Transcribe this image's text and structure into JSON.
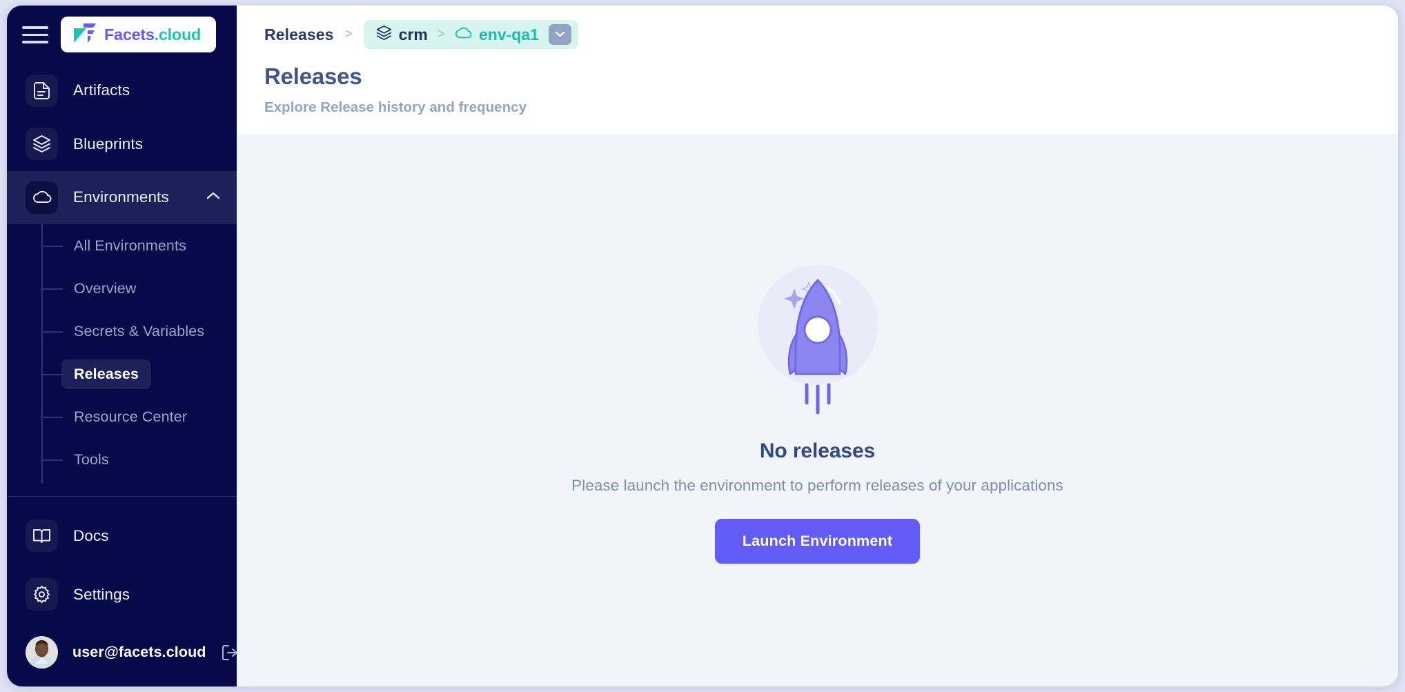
{
  "brand": {
    "logo_text_primary": "Facets",
    "logo_text_secondary": ".cloud",
    "logo_icon": "facets-logo-icon"
  },
  "sidebar": {
    "menu_icon": "hamburger-menu-icon",
    "items": [
      {
        "label": "Artifacts",
        "icon": "document-icon"
      },
      {
        "label": "Blueprints",
        "icon": "layers-icon"
      },
      {
        "label": "Environments",
        "icon": "cloud-icon",
        "expanded": true,
        "chevron": "chevron-up-icon"
      }
    ],
    "sub_items": [
      {
        "label": "All Environments",
        "active": false
      },
      {
        "label": "Overview",
        "active": false
      },
      {
        "label": "Secrets & Variables",
        "active": false
      },
      {
        "label": "Releases",
        "active": true
      },
      {
        "label": "Resource Center",
        "active": false
      },
      {
        "label": "Tools",
        "active": false
      }
    ],
    "bottom_items": [
      {
        "label": "Docs",
        "icon": "book-icon"
      },
      {
        "label": "Settings",
        "icon": "gear-icon"
      }
    ],
    "user": {
      "email": "user@facets.cloud",
      "avatar": "user-avatar",
      "logout_icon": "logout-icon"
    }
  },
  "breadcrumb": {
    "root": "Releases",
    "separator": ">",
    "project": "crm",
    "project_icon": "layers-icon",
    "environment": "env-qa1",
    "environment_icon": "cloud-icon",
    "dropdown_icon": "chevron-down-icon"
  },
  "page": {
    "title": "Releases",
    "subtitle": "Explore Release history and frequency"
  },
  "empty_state": {
    "illustration": "rocket-illustration",
    "title": "No releases",
    "description": "Please launch the environment to perform releases of your applications",
    "button_label": "Launch Environment"
  },
  "colors": {
    "sidebar_bg": "#070a49",
    "sidebar_active": "#1d2159",
    "accent_purple": "#635bf5",
    "accent_teal": "#18c5b5",
    "breadcrumb_pill": "#d7f5ee",
    "content_bg": "#f1f5fa",
    "title_blue": "#41568f"
  }
}
